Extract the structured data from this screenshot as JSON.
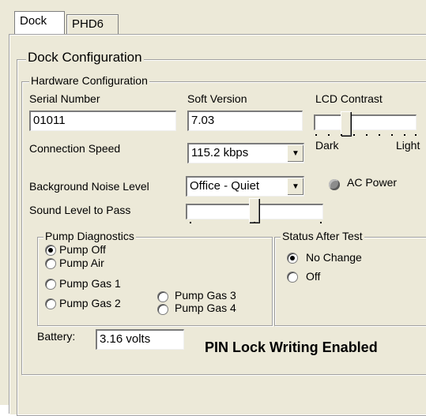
{
  "tabs": [
    {
      "label": "Dock"
    },
    {
      "label": "PHD6"
    }
  ],
  "dock_configuration": {
    "title": "Dock Configuration",
    "hardware": {
      "title": "Hardware Configuration",
      "serial_number": {
        "label": "Serial Number",
        "value": "01011"
      },
      "soft_version": {
        "label": "Soft Version",
        "value": "7.03"
      },
      "lcd_contrast": {
        "label": "LCD Contrast",
        "min_label": "Dark",
        "max_label": "Light",
        "level": 0.3
      },
      "connection_speed": {
        "label": "Connection Speed",
        "value": "115.2 kbps"
      },
      "background_noise": {
        "label": "Background Noise Level",
        "value": "Office - Quiet"
      },
      "ac_power": {
        "label": "AC Power",
        "indicator_color": "#8c8c8c"
      },
      "sound_level": {
        "label": "Sound Level to Pass",
        "level": 0.5
      }
    },
    "pump_diagnostics": {
      "title": "Pump Diagnostics",
      "options": [
        "Pump Off",
        "Pump Air",
        "Pump Gas 1",
        "Pump Gas 2",
        "Pump Gas 3",
        "Pump Gas 4"
      ],
      "selected": "Pump Off"
    },
    "status_after_test": {
      "title": "Status After Test",
      "options": [
        "No Change",
        "Off"
      ],
      "selected": "No Change"
    },
    "battery": {
      "label": "Battery:",
      "value": "3.16 volts"
    },
    "pin_lock_status": "PIN Lock Writing Enabled"
  }
}
